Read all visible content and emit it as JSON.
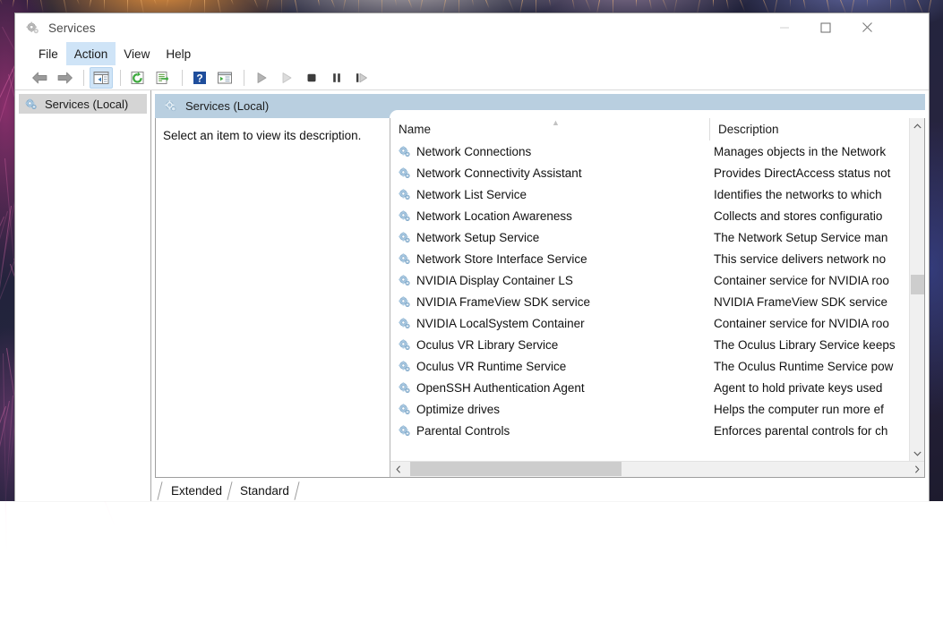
{
  "window": {
    "title": "Services",
    "icon": "services-gear-icon",
    "controls": {
      "minimize": "minimize-icon",
      "maximize": "maximize-icon",
      "close": "close-icon"
    }
  },
  "menubar": {
    "items": [
      {
        "label": "File",
        "active": false
      },
      {
        "label": "Action",
        "active": true
      },
      {
        "label": "View",
        "active": false
      },
      {
        "label": "Help",
        "active": false
      }
    ]
  },
  "toolbar": {
    "buttons": [
      {
        "name": "back-icon",
        "type": "arrow-left"
      },
      {
        "name": "forward-icon",
        "type": "arrow-right"
      },
      {
        "name": "separator",
        "type": "sep"
      },
      {
        "name": "show-hide-console-tree-icon",
        "type": "tree",
        "active": true
      },
      {
        "name": "separator",
        "type": "sep"
      },
      {
        "name": "refresh-icon",
        "type": "refresh"
      },
      {
        "name": "export-list-icon",
        "type": "export"
      },
      {
        "name": "separator",
        "type": "sep"
      },
      {
        "name": "help-icon",
        "type": "help"
      },
      {
        "name": "properties-icon",
        "type": "properties"
      },
      {
        "name": "separator",
        "type": "sep"
      },
      {
        "name": "start-service-icon",
        "type": "play"
      },
      {
        "name": "resume-service-icon",
        "type": "play-light"
      },
      {
        "name": "stop-service-icon",
        "type": "stop"
      },
      {
        "name": "pause-service-icon",
        "type": "pause"
      },
      {
        "name": "restart-service-icon",
        "type": "restart"
      }
    ]
  },
  "sidebar": {
    "node": {
      "label": "Services (Local)",
      "icon": "services-gear-icon",
      "selected": true
    }
  },
  "banner": {
    "title": "Services (Local)",
    "icon": "services-gear-icon"
  },
  "description_pane": {
    "text": "Select an item to view its description."
  },
  "list": {
    "columns": [
      {
        "key": "name",
        "label": "Name",
        "sort": "ascending"
      },
      {
        "key": "description",
        "label": "Description"
      }
    ],
    "rows": [
      {
        "name": "Network Connections",
        "description": "Manages objects in the Network"
      },
      {
        "name": "Network Connectivity Assistant",
        "description": "Provides DirectAccess status not"
      },
      {
        "name": "Network List Service",
        "description": "Identifies the networks to which"
      },
      {
        "name": "Network Location Awareness",
        "description": "Collects and stores configuratio"
      },
      {
        "name": "Network Setup Service",
        "description": "The Network Setup Service man"
      },
      {
        "name": "Network Store Interface Service",
        "description": "This service delivers network no"
      },
      {
        "name": "NVIDIA Display Container LS",
        "description": "Container service for NVIDIA roo"
      },
      {
        "name": "NVIDIA FrameView SDK service",
        "description": "NVIDIA FrameView SDK service"
      },
      {
        "name": "NVIDIA LocalSystem Container",
        "description": "Container service for NVIDIA roo"
      },
      {
        "name": "Oculus VR Library Service",
        "description": "The Oculus Library Service keeps"
      },
      {
        "name": "Oculus VR Runtime Service",
        "description": "The Oculus Runtime Service pow"
      },
      {
        "name": "OpenSSH Authentication Agent",
        "description": "Agent to hold private keys used"
      },
      {
        "name": "Optimize drives",
        "description": "Helps the computer run more ef"
      },
      {
        "name": "Parental Controls",
        "description": "Enforces parental controls for ch"
      }
    ]
  },
  "scrollbars": {
    "vertical": {
      "up": "chevron-up-icon",
      "down": "chevron-down-icon"
    },
    "horizontal": {
      "left": "chevron-left-icon",
      "right": "chevron-right-icon"
    }
  },
  "tabs": [
    {
      "label": "Extended",
      "selected": false
    },
    {
      "label": "Standard",
      "selected": true
    }
  ],
  "colors": {
    "banner": "#b9cfe0",
    "menu_highlight": "#cfe4f7",
    "selection": "#d5d5d5",
    "gear_icon": "#8fb8d8",
    "scrollbar_thumb": "#cdcdcd"
  }
}
